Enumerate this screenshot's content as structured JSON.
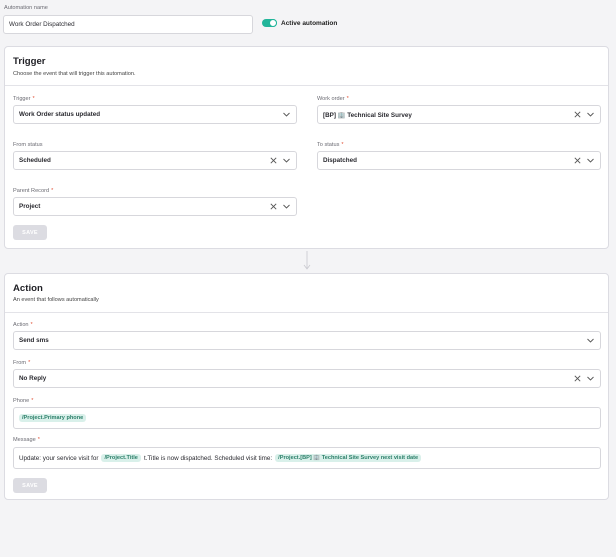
{
  "header": {
    "name_label": "Automation name",
    "name_value": "Work Order Dispatched",
    "active_label": "Active automation",
    "active": true
  },
  "trigger": {
    "title": "Trigger",
    "subtitle": "Choose the event that will trigger this automation.",
    "trigger_label": "Trigger",
    "trigger_value": "Work Order status updated",
    "work_order_label": "Work order",
    "work_order_value": "[BP] 🏢 Technical Site Survey",
    "from_status_label": "From status",
    "from_status_value": "Scheduled",
    "to_status_label": "To status",
    "to_status_value": "Dispatched",
    "parent_record_label": "Parent Record",
    "parent_record_value": "Project",
    "save_label": "SAVE"
  },
  "action": {
    "title": "Action",
    "subtitle": "An event that follows automatically",
    "action_label": "Action",
    "action_value": "Send sms",
    "from_label": "From",
    "from_value": "No Reply",
    "phone_label": "Phone",
    "phone_tag": "/Project.Primary phone",
    "message_label": "Message",
    "message_part1": "Update: your service visit for",
    "message_tag1": "/Project.Title",
    "message_part2": "t.Title is now dispatched. Scheduled visit time:",
    "message_tag2": "/Project.[BP] 🏢 Technical Site Survey next visit date",
    "save_label": "SAVE"
  },
  "colors": {
    "accent": "#22b59a",
    "tag_bg": "#d9f0ea",
    "tag_text": "#2b7f69",
    "required": "#e2553b"
  },
  "icons": [
    "chevron-down-icon",
    "clear-x-icon",
    "arrow-down-icon"
  ]
}
